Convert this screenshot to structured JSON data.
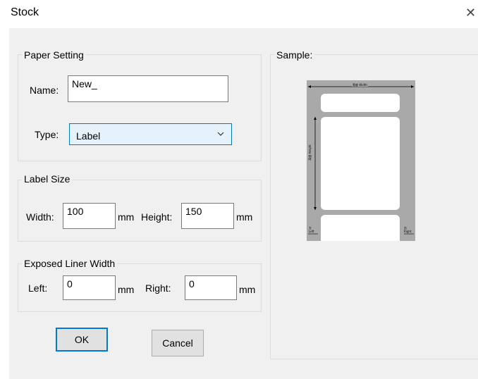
{
  "window": {
    "title": "Stock",
    "close_glyph": "✕"
  },
  "paper_setting": {
    "group_title": "Paper Setting",
    "name_label": "Name:",
    "name_value": "New_",
    "type_label": "Type:",
    "type_value": "Label"
  },
  "label_size": {
    "group_title": "Label Size",
    "width_label": "Width:",
    "width_value": "100",
    "width_unit": "mm",
    "height_label": "Height:",
    "height_value": "150",
    "height_unit": "mm"
  },
  "liner": {
    "group_title": "Exposed Liner Width",
    "left_label": "Left:",
    "left_value": "0",
    "left_unit": "mm",
    "right_label": "Right:",
    "right_value": "0",
    "right_unit": "mm"
  },
  "buttons": {
    "ok": "OK",
    "cancel": "Cancel"
  },
  "sample": {
    "group_title": "Sample:",
    "width_caption": "宽度 Width",
    "height_caption": "高度 Height",
    "left_caption": "左 Left",
    "right_caption": "右 Right"
  },
  "colors": {
    "accent": "#0078d7",
    "panel": "#f0f0f0",
    "sample_bg": "#a9a9a9"
  }
}
